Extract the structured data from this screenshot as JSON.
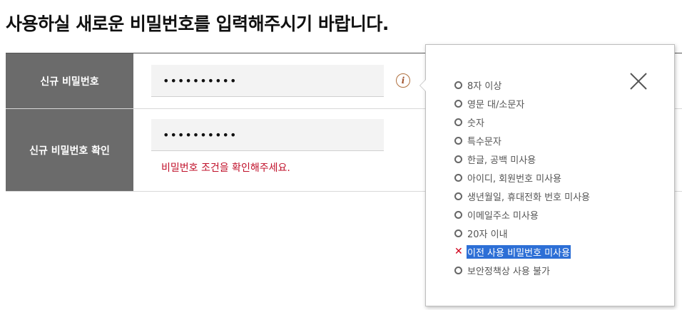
{
  "page_title": "사용하실 새로운 비밀번호를 입력해주시기 바랍니다.",
  "form": {
    "new_password_label": "신규 비밀번호",
    "new_password_value": "••••••••••",
    "confirm_password_label": "신규 비밀번호 확인",
    "confirm_password_value": "••••••••••",
    "error_message": "비밀번호 조건을 확인해주세요."
  },
  "info_icon": {
    "icon": "info-icon",
    "glyph": "i"
  },
  "tooltip": {
    "close_icon": "close-icon",
    "rules": [
      {
        "text": "8자 이상",
        "status": "neutral"
      },
      {
        "text": "영문 대/소문자",
        "status": "neutral"
      },
      {
        "text": "숫자",
        "status": "neutral"
      },
      {
        "text": "특수문자",
        "status": "neutral"
      },
      {
        "text": "한글, 공백 미사용",
        "status": "neutral"
      },
      {
        "text": "아이디, 회원번호 미사용",
        "status": "neutral"
      },
      {
        "text": "생년월일, 휴대전화 번호 미사용",
        "status": "neutral"
      },
      {
        "text": "이메일주소 미사용",
        "status": "neutral"
      },
      {
        "text": "20자 이내",
        "status": "neutral"
      },
      {
        "text": "이전 사용 비밀번호 미사용",
        "status": "failed",
        "selected": true
      },
      {
        "text": "보안정책상 사용 불가",
        "status": "neutral"
      }
    ]
  },
  "colors": {
    "label_bg": "#6b6b6b",
    "error": "#c0102a",
    "fail_mark": "#d0021b",
    "selection": "#2d6fd6"
  }
}
